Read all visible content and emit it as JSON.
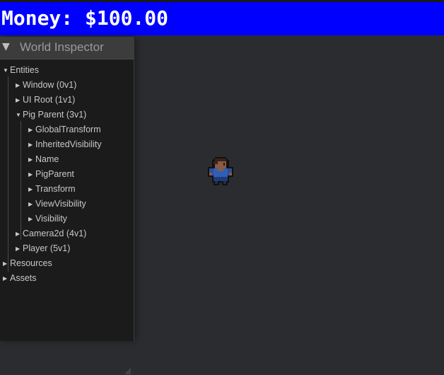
{
  "hud": {
    "money_text": "Money: $100.00"
  },
  "inspector": {
    "title": "World Inspector",
    "collapse_glyph": "▼",
    "rows": {
      "entities": "Entities",
      "window": "Window (0v1)",
      "ui_root": "UI Root (1v1)",
      "pig_parent": "Pig Parent (3v1)",
      "global_transform": "GlobalTransform",
      "inherited_visibility": "InheritedVisibility",
      "name": "Name",
      "pig_parent_comp": "PigParent",
      "transform": "Transform",
      "view_visibility": "ViewVisibility",
      "visibility": "Visibility",
      "camera2d": "Camera2d (4v1)",
      "player": "Player (5v1)",
      "resources": "Resources",
      "assets": "Assets"
    }
  },
  "colors": {
    "hud_bar": "#0000ff",
    "panel_bg": "#1b1b1b",
    "viewport_bg": "#2b2c2f"
  }
}
